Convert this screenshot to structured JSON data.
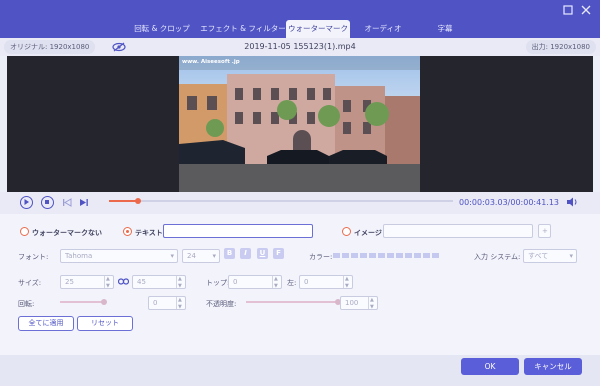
{
  "window": {
    "tabs": [
      {
        "label": "回転 & クロップ"
      },
      {
        "label": "エフェクト & フィルター"
      },
      {
        "label": "ウォーターマーク"
      },
      {
        "label": "オーディオ"
      },
      {
        "label": "字幕"
      }
    ],
    "active_tab": "ウォーターマーク"
  },
  "info": {
    "original_label": "オリジナル: 1920x1080",
    "filename": "2019-11-05 155123(1).mp4",
    "output_label": "出力: 1920x1080"
  },
  "preview": {
    "watermark_text": "www.  Aiseesoft .jp"
  },
  "player": {
    "timecode": "00:00:03.03/00:00:41.13",
    "progress": 0.083
  },
  "watermark": {
    "none_label": "ウォーターマークない",
    "text_label": "テキスト",
    "text_value": "",
    "image_label": "イメージ",
    "image_value": "",
    "add_image": "+",
    "selected": "テキスト"
  },
  "font": {
    "label": "フォント:",
    "family": "Tahoma",
    "size": "24",
    "bold": "B",
    "italic": "I",
    "underline": "U",
    "strike": "F",
    "color_label": "カラー:",
    "input_system_label": "入力 システム:",
    "input_system_value": "すべて"
  },
  "size": {
    "label": "サイズ:",
    "width": "25",
    "height": "45",
    "top_label": "トップ:",
    "top": "0",
    "left_label": "左:",
    "left": "0"
  },
  "rotation": {
    "label": "回転:",
    "value": "0",
    "opacity_label": "不透明度:",
    "opacity": "100"
  },
  "actions": {
    "apply_all": "全てに適用",
    "reset": "リセット",
    "ok": "OK",
    "cancel": "キャンセル"
  },
  "colors": {
    "accent": "#4f53c4",
    "highlight": "#ec6a4b"
  }
}
